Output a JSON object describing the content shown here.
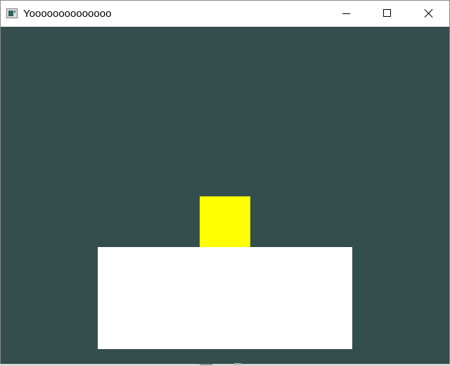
{
  "window": {
    "title": "Yoooooooooooooo",
    "controls": {
      "minimize_icon": "minimize-icon",
      "maximize_icon": "maximize-icon",
      "close_icon": "close-icon"
    }
  },
  "scene": {
    "background_color": "#344d4d",
    "shapes": [
      {
        "name": "yellow-square",
        "color": "#ffff00"
      },
      {
        "name": "white-rectangle",
        "color": "#ffffff"
      }
    ]
  }
}
